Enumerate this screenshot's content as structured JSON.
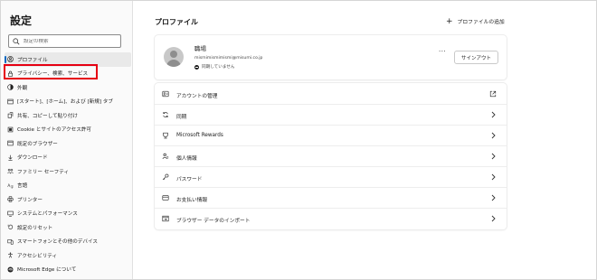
{
  "sidebar": {
    "title": "設定",
    "search_placeholder": "設定の検索",
    "items": [
      {
        "label": "プロファイル",
        "icon": "profile-icon"
      },
      {
        "label": "プライバシー、検索、サービス",
        "icon": "lock-icon"
      },
      {
        "label": "外観",
        "icon": "palette-icon"
      },
      {
        "label": "[スタート]、[ホーム]、および [新規] タブ",
        "icon": "start-home-icon"
      },
      {
        "label": "共有、コピーして貼り付け",
        "icon": "share-icon"
      },
      {
        "label": "Cookie とサイトのアクセス許可",
        "icon": "cookie-icon"
      },
      {
        "label": "既定のブラウザー",
        "icon": "browser-icon"
      },
      {
        "label": "ダウンロード",
        "icon": "download-icon"
      },
      {
        "label": "ファミリー セーフティ",
        "icon": "family-icon"
      },
      {
        "label": "言語",
        "icon": "language-icon"
      },
      {
        "label": "プリンター",
        "icon": "printer-icon"
      },
      {
        "label": "システムとパフォーマンス",
        "icon": "system-icon"
      },
      {
        "label": "設定のリセット",
        "icon": "reset-icon"
      },
      {
        "label": "スマートフォンとその他のデバイス",
        "icon": "phone-icon"
      },
      {
        "label": "アクセシビリティ",
        "icon": "accessibility-icon"
      },
      {
        "label": "Microsoft Edge について",
        "icon": "edge-icon"
      }
    ]
  },
  "main": {
    "title": "プロファイル",
    "add_profile_label": "プロファイルの追加",
    "profile": {
      "name": "職場",
      "email": "mismimismimismi@misumi.co.jp",
      "sync_status": "同期していません",
      "more_label": "···",
      "signout_label": "サインアウト"
    },
    "rows": [
      {
        "label": "アカウントの管理",
        "icon": "account-icon",
        "trailing": "external-link-icon"
      },
      {
        "label": "同期",
        "icon": "sync-icon",
        "trailing": "chevron-right-icon"
      },
      {
        "label": "Microsoft Rewards",
        "icon": "rewards-icon",
        "trailing": "chevron-right-icon"
      },
      {
        "label": "個人情報",
        "icon": "personal-info-icon",
        "trailing": "chevron-right-icon"
      },
      {
        "label": "パスワード",
        "icon": "key-icon",
        "trailing": "chevron-right-icon"
      },
      {
        "label": "お支払い情報",
        "icon": "card-icon",
        "trailing": "chevron-right-icon"
      },
      {
        "label": "ブラウザー データのインポート",
        "icon": "import-icon",
        "trailing": "chevron-right-icon"
      }
    ]
  },
  "colors": {
    "accent": "#0067c0",
    "highlight": "#e60012"
  }
}
